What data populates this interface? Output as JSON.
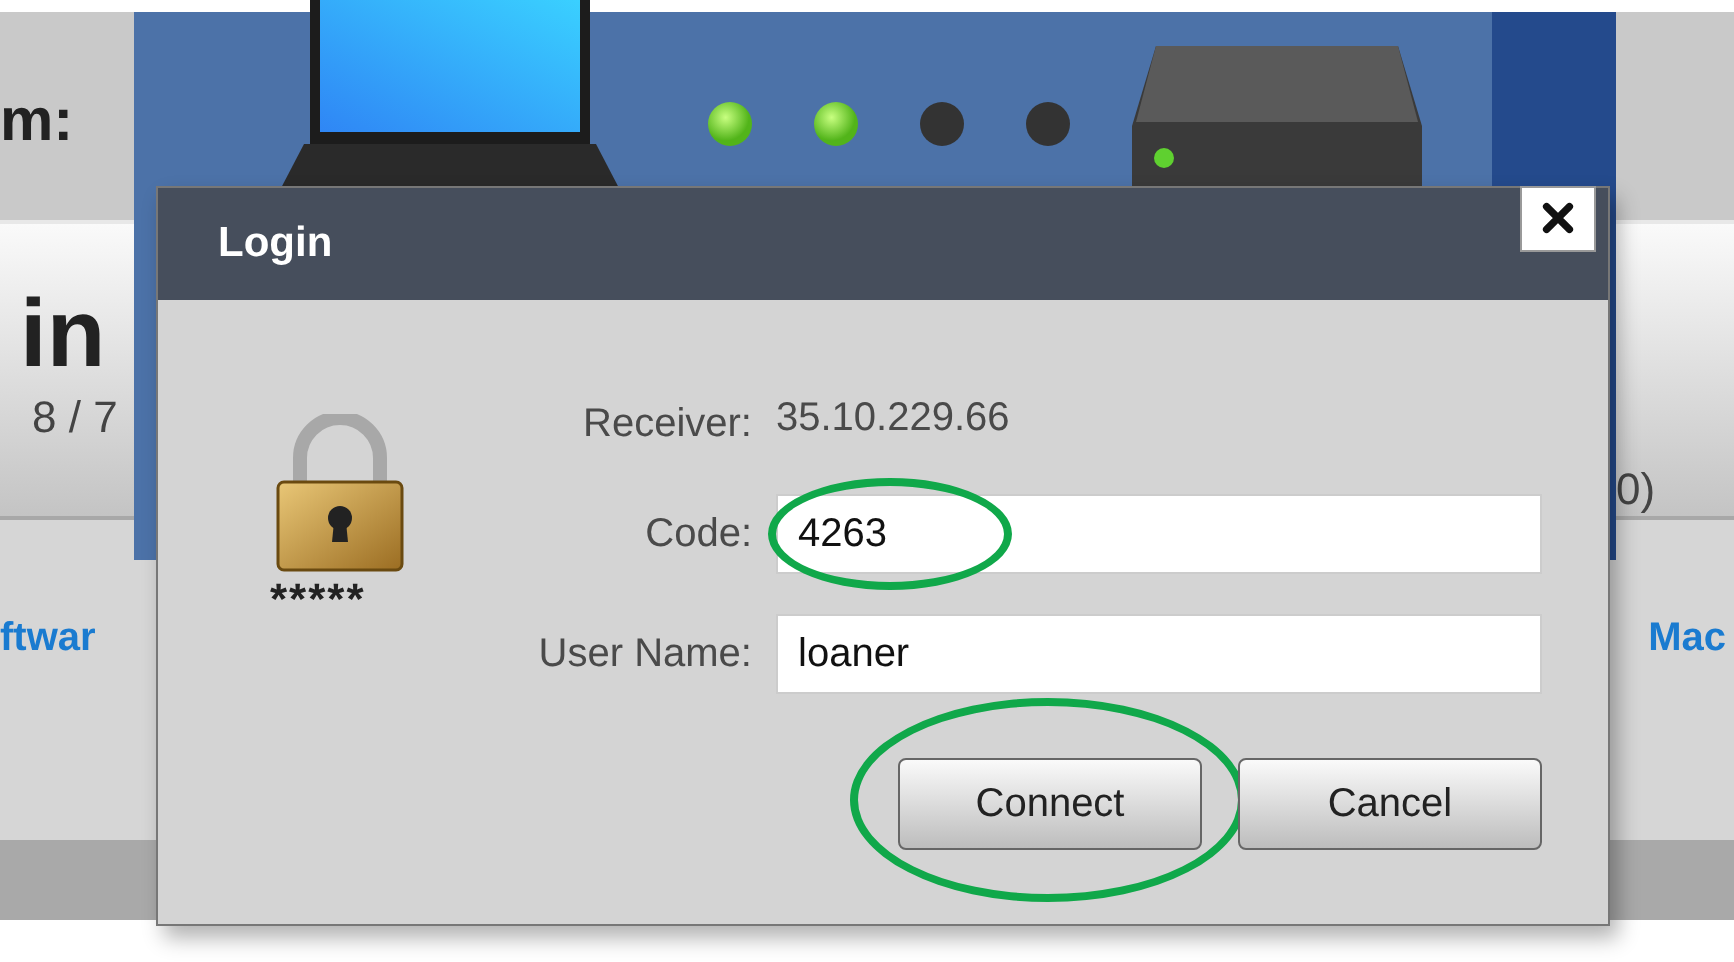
{
  "page": {
    "label_fragment": "m:",
    "heading_fragment": "in",
    "date_fragment": "8 / 7",
    "count_fragment": "0)",
    "link_left_fragment": "ftwar",
    "link_right_fragment": "Mac"
  },
  "status_panel": {
    "leds": [
      {
        "on": true
      },
      {
        "on": true
      },
      {
        "on": false
      },
      {
        "on": false
      }
    ]
  },
  "dialog": {
    "title": "Login",
    "lock_mask": "*****",
    "receiver_label": "Receiver:",
    "receiver_value": "35.10.229.66",
    "fields": [
      {
        "label": "Code:",
        "value": "4263",
        "annotated": true
      },
      {
        "label": "User Name:",
        "value": "loaner",
        "annotated": false
      }
    ],
    "buttons": [
      {
        "label": "Connect",
        "annotated": true
      },
      {
        "label": "Cancel",
        "annotated": false
      }
    ]
  }
}
